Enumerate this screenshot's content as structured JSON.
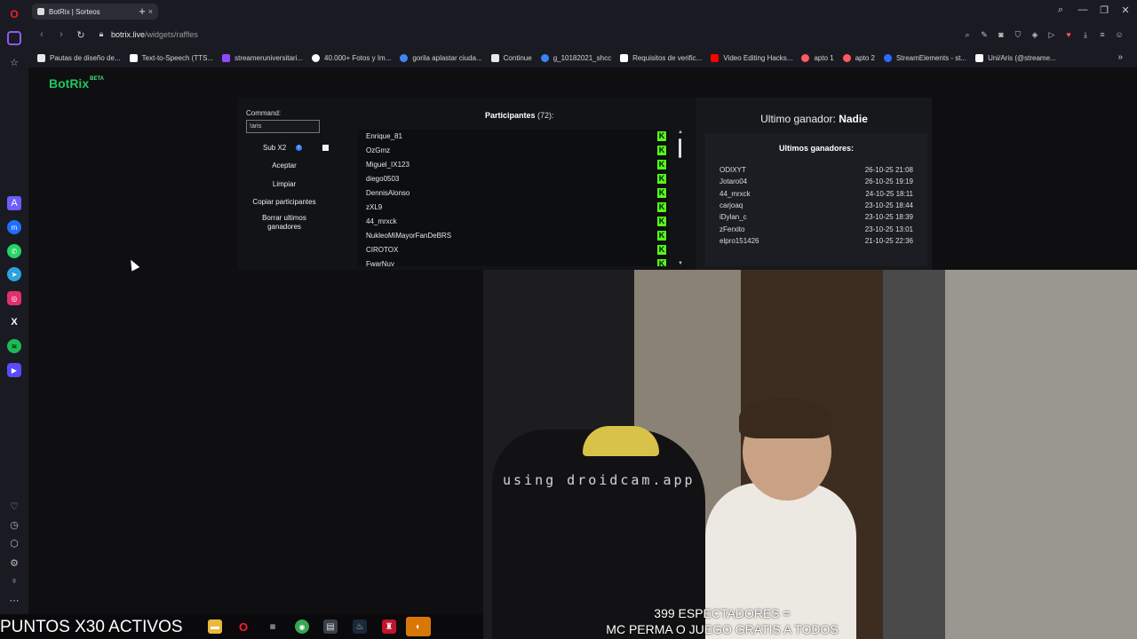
{
  "browser": {
    "tab_title": "BotRix | Sorteos",
    "tab_close": "×",
    "new_tab": "+",
    "url_domain": "botrix.live",
    "url_path": "/widgets/raffles",
    "bookmarks": [
      {
        "label": "Pautas de diseño de...",
        "color": "#e8e8e8"
      },
      {
        "label": "Text-to-Speech (TTS...",
        "color": "#ffffff"
      },
      {
        "label": "streameruniversitari...",
        "color": "#9146ff"
      },
      {
        "label": "40.000+ Fotos y Im...",
        "color": "#ffffff"
      },
      {
        "label": "gorila aplastar ciuda...",
        "color": "#4285f4"
      },
      {
        "label": "Continue",
        "color": "#e8e8e8"
      },
      {
        "label": "g_10182021_shcc",
        "color": "#3b82f6"
      },
      {
        "label": "Requisitos de verific...",
        "color": "#ffffff"
      },
      {
        "label": "Video Editing Hacks...",
        "color": "#ff0000"
      },
      {
        "label": "apto 1",
        "color": "#ff5a5f"
      },
      {
        "label": "apto 2",
        "color": "#ff5a5f"
      },
      {
        "label": "StreamElements - st...",
        "color": "#2b6cff"
      },
      {
        "label": "Uni/Aris (@streame...",
        "color": "#ffffff"
      }
    ],
    "bookmarks_more": "»"
  },
  "botrix": {
    "logo": "BotRix",
    "logo_badge": "BETA",
    "command_label": "Command:",
    "command_value": "!aris",
    "sub_label": "Sub X2",
    "sub_checked": true,
    "buttons": {
      "accept": "Aceptar",
      "clear": "Limpiar",
      "copy": "Copiar participantes",
      "delete_winners": "Borrar ultimos ganadores"
    },
    "participants_label": "Participantes",
    "participants_count": "(72):",
    "participants": [
      "Enrique_81",
      "OzGmz",
      "Miguel_IX123",
      "diego0503",
      "DennisAlonso",
      "zXL9",
      "44_mrxck",
      "NukleoMiMayorFanDeBRS",
      "CIROTOX",
      "FwarNuy"
    ],
    "platform_icon": "K",
    "last_winner_label": "Ultimo ganador:",
    "last_winner_name": "Nadie",
    "recent_winners_title": "Ultimos ganadores:",
    "recent_winners": [
      {
        "name": "ODIXYT",
        "date": "26-10-25 21:08"
      },
      {
        "name": "Jotaro04",
        "date": "26-10-25 19:19"
      },
      {
        "name": "44_mrxck",
        "date": "24-10-25 18:11"
      },
      {
        "name": "carjoaq",
        "date": "23-10-25 18:44"
      },
      {
        "name": "iDylan_c",
        "date": "23-10-25 18:39"
      },
      {
        "name": "zFerxito",
        "date": "23-10-25 13:01"
      },
      {
        "name": "elpro151426",
        "date": "21-10-25 22:36"
      }
    ]
  },
  "overlay": {
    "camera_watermark": "using droidcam.app",
    "viewers_line1": "399 ESPECTADORES =",
    "viewers_line2": "MC PERMA O JUEGO GRATIS A TODOS",
    "points_banner": "PUNTOS X30 ACTIVOS"
  },
  "colors": {
    "accent_green": "#53fc18",
    "botrix_green": "#22c55e",
    "sidebar_bg": "#1a1b22"
  }
}
